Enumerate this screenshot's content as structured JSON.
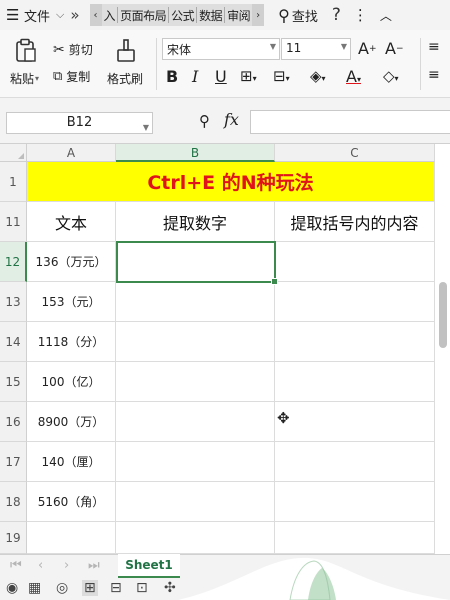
{
  "menubar": {
    "file_label": "文件",
    "tabs": [
      "入",
      "页面布局",
      "公式",
      "数据",
      "审阅"
    ],
    "search_label": "查找",
    "help_label": "?",
    "more_label": "⋮"
  },
  "ribbon": {
    "paste_label": "粘贴",
    "cut_label": "剪切",
    "copy_label": "复制",
    "format_painter_label": "格式刷",
    "font_name": "宋体",
    "font_size": "11",
    "bold": "B",
    "italic": "I",
    "underline": "U"
  },
  "formula_bar": {
    "cell_ref": "B12",
    "fx_label": "fx",
    "value": ""
  },
  "grid": {
    "columns": [
      "A",
      "B",
      "C"
    ],
    "title_row": {
      "row": "1",
      "text": "Ctrl+E 的N种玩法"
    },
    "header_row": {
      "row": "11",
      "cells": [
        "文本",
        "提取数字",
        "提取括号内的内容"
      ]
    },
    "rows": [
      {
        "row": "12",
        "a": "136（万元）",
        "b": "",
        "c": ""
      },
      {
        "row": "13",
        "a": "153（元）",
        "b": "",
        "c": ""
      },
      {
        "row": "14",
        "a": "1118（分）",
        "b": "",
        "c": ""
      },
      {
        "row": "15",
        "a": "100（亿）",
        "b": "",
        "c": ""
      },
      {
        "row": "16",
        "a": "8900（万）",
        "b": "",
        "c": ""
      },
      {
        "row": "17",
        "a": "140（厘）",
        "b": "",
        "c": ""
      },
      {
        "row": "18",
        "a": "5160（角）",
        "b": "",
        "c": ""
      }
    ],
    "last_row": "19"
  },
  "sheets": {
    "active": "Sheet1"
  },
  "colors": {
    "accent": "#217346",
    "selection": "#3c8a4e",
    "title_fill": "#ffff00",
    "title_text": "#e0121a"
  }
}
